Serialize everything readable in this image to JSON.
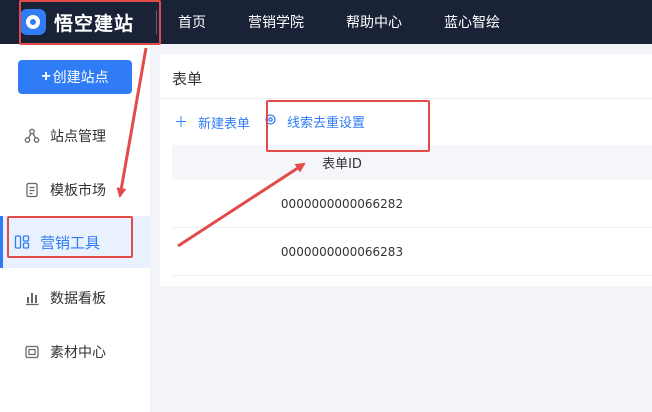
{
  "logo": {
    "text": "悟空建站"
  },
  "nav": {
    "items": [
      "首页",
      "营销学院",
      "帮助中心",
      "蓝心智绘"
    ]
  },
  "sidebar": {
    "create_label": "创建站点",
    "items": [
      {
        "label": "站点管理",
        "icon": "sitemap-icon"
      },
      {
        "label": "模板市场",
        "icon": "template-icon"
      },
      {
        "label": "营销工具",
        "icon": "marketing-tool-icon"
      },
      {
        "label": "数据看板",
        "icon": "bar-chart-icon"
      },
      {
        "label": "素材中心",
        "icon": "material-icon"
      }
    ]
  },
  "main": {
    "title": "表单",
    "actions": [
      {
        "label": "新建表单",
        "icon": "plus-icon"
      },
      {
        "label": "线索去重设置",
        "icon": "settings-icon"
      }
    ],
    "table": {
      "header": "表单ID",
      "rows": [
        "0000000000066282",
        "0000000000066283"
      ]
    }
  },
  "colors": {
    "topbar": "#1a2238",
    "accent": "#2f7cf6",
    "annotation": "#e34b4b"
  }
}
